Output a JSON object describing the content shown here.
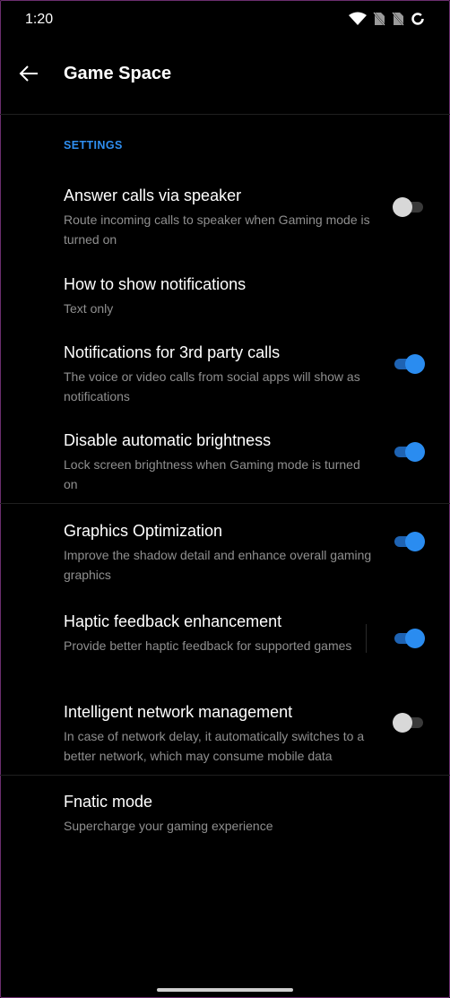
{
  "status_bar": {
    "time": "1:20",
    "icons": [
      "wifi-icon",
      "no-sim-icon",
      "no-sim-icon",
      "battery-saver-icon"
    ]
  },
  "app_bar": {
    "title": "Game Space",
    "back_icon": "arrow-back-icon"
  },
  "section": {
    "header": "SETTINGS"
  },
  "settings": [
    {
      "title": "Answer calls via speaker",
      "description": "Route incoming calls to speaker when Gaming mode is turned on",
      "toggle": false
    },
    {
      "title": "How to show notifications",
      "description": "Text only"
    },
    {
      "title": "Notifications for 3rd party calls",
      "description": "The voice or video calls from social apps will show as notifications",
      "toggle": true
    },
    {
      "title": "Disable automatic brightness",
      "description": "Lock screen brightness when Gaming mode is turned on",
      "toggle": true
    },
    {
      "title": "Graphics Optimization",
      "description": "Improve the shadow detail and enhance overall gaming graphics",
      "toggle": true
    },
    {
      "title": "Haptic feedback enhancement",
      "description": "Provide better haptic feedback for supported games",
      "toggle": true
    },
    {
      "title": "Intelligent network management",
      "description": "In case of network delay, it automatically switches to a better network, which may consume mobile data",
      "toggle": false
    },
    {
      "title": "Fnatic mode",
      "description": "Supercharge your gaming experience"
    }
  ],
  "colors": {
    "background": "#000000",
    "accent": "#2a8cf0",
    "secondary_text": "#8f8f8f",
    "frame": "#6b2e6f"
  }
}
